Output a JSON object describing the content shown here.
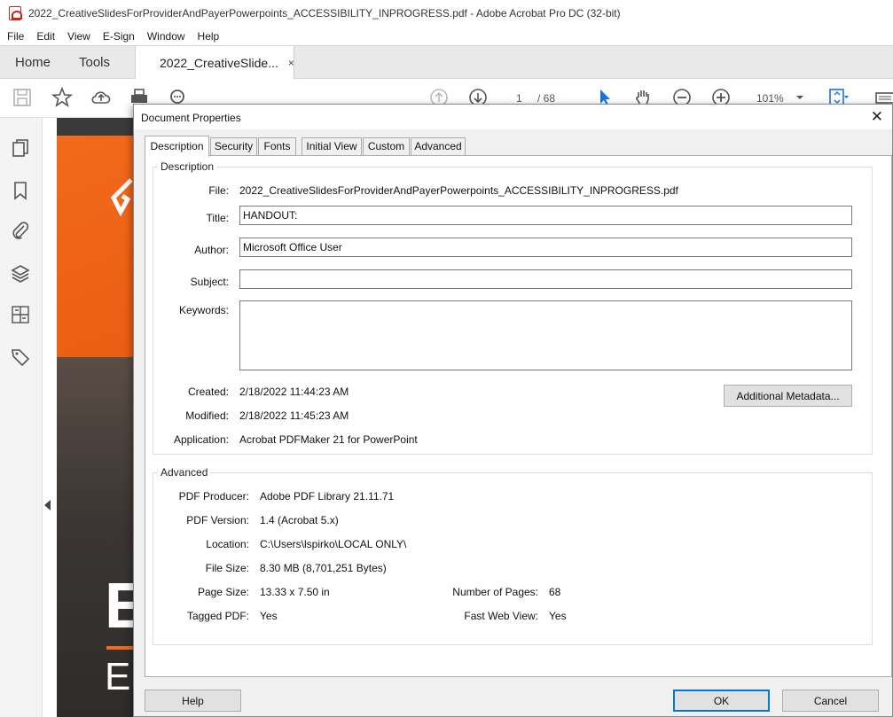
{
  "window": {
    "title": "2022_CreativeSlidesForProviderAndPayerPowerpoints_ACCESSIBILITY_INPROGRESS.pdf - Adobe Acrobat Pro DC (32-bit)"
  },
  "menu": [
    "File",
    "Edit",
    "View",
    "E-Sign",
    "Window",
    "Help"
  ],
  "tabs": {
    "home": "Home",
    "tools": "Tools",
    "document": "2022_CreativeSlide...",
    "close": "×"
  },
  "toolbar": {
    "page_current": "1",
    "page_total": "/ 68",
    "zoom": "101%"
  },
  "dialog": {
    "title": "Document Properties",
    "close": "✕",
    "tabs": [
      "Description",
      "Security",
      "Fonts",
      "Initial View",
      "Custom",
      "Advanced"
    ],
    "description": {
      "group_label": "Description",
      "file_label": "File:",
      "file_value": "2022_CreativeSlidesForProviderAndPayerPowerpoints_ACCESSIBILITY_INPROGRESS.pdf",
      "title_label": "Title:",
      "title_value": "HANDOUT:",
      "author_label": "Author:",
      "author_value": "Microsoft Office User",
      "subject_label": "Subject:",
      "subject_value": "",
      "keywords_label": "Keywords:",
      "keywords_value": "",
      "created_label": "Created:",
      "created_value": "2/18/2022 11:44:23 AM",
      "modified_label": "Modified:",
      "modified_value": "2/18/2022 11:45:23 AM",
      "application_label": "Application:",
      "application_value": "Acrobat PDFMaker 21 for PowerPoint",
      "metadata_button": "Additional Metadata..."
    },
    "advanced": {
      "group_label": "Advanced",
      "producer_label": "PDF Producer:",
      "producer_value": "Adobe PDF Library 21.11.71",
      "version_label": "PDF Version:",
      "version_value": "1.4 (Acrobat 5.x)",
      "location_label": "Location:",
      "location_value": "C:\\Users\\lspirko\\LOCAL ONLY\\",
      "filesize_label": "File Size:",
      "filesize_value": "8.30 MB (8,701,251 Bytes)",
      "pagesize_label": "Page Size:",
      "pagesize_value": "13.33 x 7.50 in",
      "numpages_label": "Number of Pages:",
      "numpages_value": "68",
      "tagged_label": "Tagged PDF:",
      "tagged_value": "Yes",
      "fastweb_label": "Fast Web View:",
      "fastweb_value": "Yes"
    },
    "buttons": {
      "help": "Help",
      "ok": "OK",
      "cancel": "Cancel"
    }
  },
  "slide": {
    "big_text": "E",
    "small_text": "E"
  },
  "colors": {
    "accent_orange": "#f26a1b",
    "dialog_bg": "#f0f0f0",
    "focus_blue": "#0078d7",
    "acrobat_red": "#c8251b"
  }
}
